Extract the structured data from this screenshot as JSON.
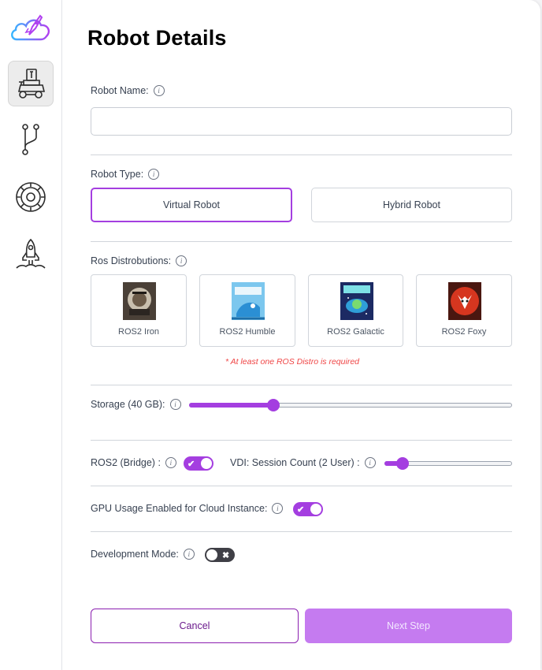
{
  "page": {
    "title": "Robot Details"
  },
  "sidebar": {
    "items": [
      {
        "name": "robot",
        "icon": "robot-icon",
        "active": true
      },
      {
        "name": "branch",
        "icon": "branch-icon",
        "active": false
      },
      {
        "name": "settings",
        "icon": "gear-icon",
        "active": false
      },
      {
        "name": "launch",
        "icon": "rocket-launch-icon",
        "active": false
      }
    ]
  },
  "form": {
    "robot_name": {
      "label": "Robot Name:",
      "value": "",
      "placeholder": ""
    },
    "robot_type": {
      "label": "Robot Type:",
      "options": [
        "Virtual Robot",
        "Hybrid Robot"
      ],
      "selected": "Virtual Robot"
    },
    "ros_distros": {
      "label": "Ros Distrobutions:",
      "options": [
        "ROS2 Iron",
        "ROS2 Humble",
        "ROS2 Galactic",
        "ROS2 Foxy"
      ],
      "error": "* At least one ROS Distro is required"
    },
    "storage": {
      "label": "Storage (40 GB):",
      "value_gb": 40,
      "fraction": 0.26
    },
    "ros2_bridge": {
      "label": "ROS2 (Bridge) :",
      "enabled": true
    },
    "vdi_session": {
      "label": "VDI: Session Count (2 User) :",
      "value": 2,
      "fraction": 0.14
    },
    "gpu_usage": {
      "label": "GPU Usage Enabled for Cloud Instance:",
      "enabled": true
    },
    "development_mode": {
      "label": "Development Mode:",
      "enabled": false
    }
  },
  "actions": {
    "cancel_label": "Cancel",
    "next_label": "Next Step"
  },
  "colors": {
    "accent": "#a43ee0",
    "accent_light": "#c57bf0",
    "error": "#ef4444"
  }
}
